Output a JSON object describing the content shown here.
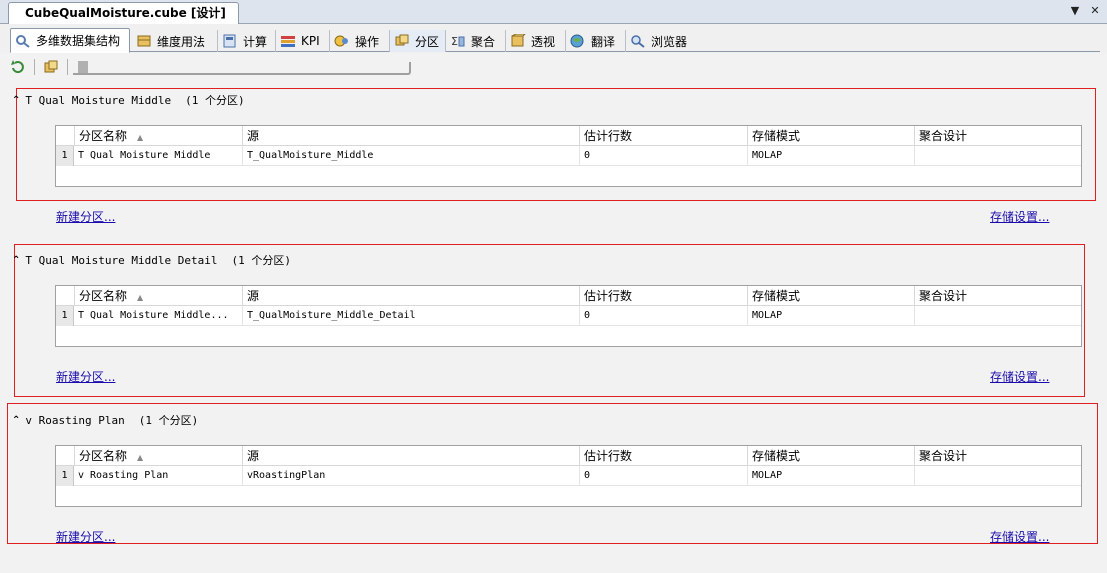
{
  "document": {
    "tab_title": "CubeQualMoisture.cube [设计]"
  },
  "tabs": [
    {
      "label": "多维数据集结构",
      "icon": "cube-structure-icon"
    },
    {
      "label": "维度用法",
      "icon": "dimension-usage-icon"
    },
    {
      "label": "计算",
      "icon": "calculations-icon"
    },
    {
      "label": "KPI",
      "icon": "kpi-icon"
    },
    {
      "label": "操作",
      "icon": "actions-icon"
    },
    {
      "label": "分区",
      "icon": "partitions-icon"
    },
    {
      "label": "聚合",
      "icon": "aggregations-icon"
    },
    {
      "label": "透视",
      "icon": "perspectives-icon"
    },
    {
      "label": "翻译",
      "icon": "translations-icon"
    },
    {
      "label": "浏览器",
      "icon": "browser-icon"
    }
  ],
  "active_tab": "分区",
  "grid_columns": [
    "分区名称",
    "源",
    "估计行数",
    "存储模式",
    "聚合设计"
  ],
  "sections": [
    {
      "name": "T Qual Moisture Middle",
      "count_label": "(1 个分区)",
      "rows": [
        {
          "num": "1",
          "name": "T Qual Moisture Middle",
          "source": "T_QualMoisture_Middle",
          "rows": "0",
          "storage": "MOLAP",
          "aggregation": ""
        }
      ],
      "new_link": "新建分区...",
      "storage_link": "存储设置..."
    },
    {
      "name": "T Qual Moisture Middle Detail",
      "count_label": "(1 个分区)",
      "rows": [
        {
          "num": "1",
          "name": "T Qual Moisture Middle...",
          "source": "T_QualMoisture_Middle_Detail",
          "rows": "0",
          "storage": "MOLAP",
          "aggregation": ""
        }
      ],
      "new_link": "新建分区...",
      "storage_link": "存储设置..."
    },
    {
      "name": "v Roasting Plan",
      "count_label": "(1 个分区)",
      "rows": [
        {
          "num": "1",
          "name": "v Roasting Plan",
          "source": "vRoastingPlan",
          "rows": "0",
          "storage": "MOLAP",
          "aggregation": ""
        }
      ],
      "new_link": "新建分区...",
      "storage_link": "存储设置..."
    }
  ],
  "window_controls": {
    "dropdown": "▼",
    "close": "✕"
  }
}
